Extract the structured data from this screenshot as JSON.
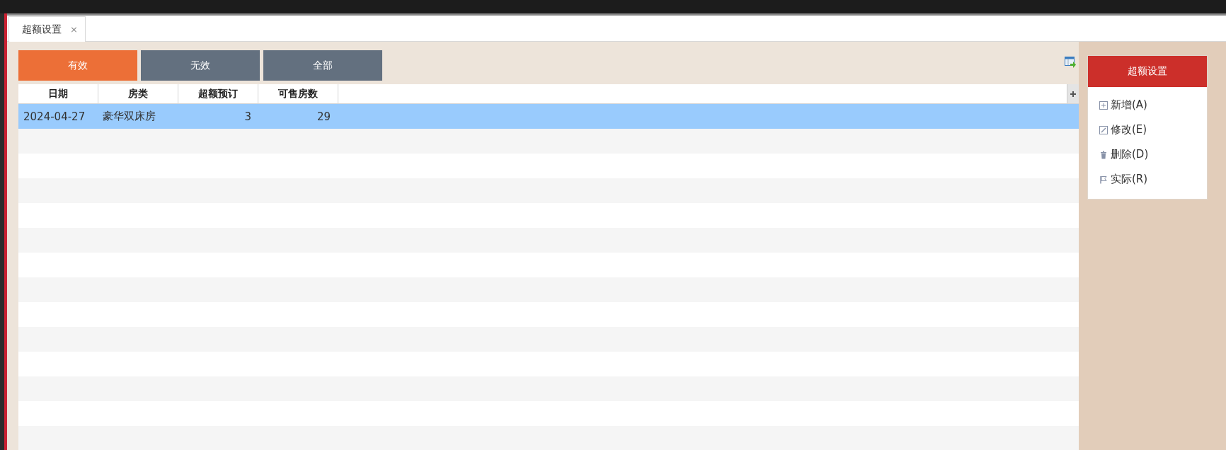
{
  "tabs": [
    {
      "label": "超额设置",
      "selected": true,
      "close": "×"
    }
  ],
  "filters": [
    {
      "label": "有效",
      "selected": true
    },
    {
      "label": "无效",
      "selected": false
    },
    {
      "label": "全部",
      "selected": false
    }
  ],
  "table": {
    "columns": [
      "日期",
      "房类",
      "超额预订",
      "可售房数"
    ],
    "rows": [
      {
        "cells": [
          "2024-04-27",
          "豪华双床房",
          "3",
          "29"
        ],
        "selected": true
      }
    ]
  },
  "side_panel": {
    "title": "超额设置",
    "items": [
      {
        "kind": "add",
        "label": "新增(A)"
      },
      {
        "kind": "edit",
        "label": "修改(E)"
      },
      {
        "kind": "delete",
        "label": "删除(D)"
      },
      {
        "kind": "flag",
        "label": "实际(R)"
      }
    ]
  }
}
